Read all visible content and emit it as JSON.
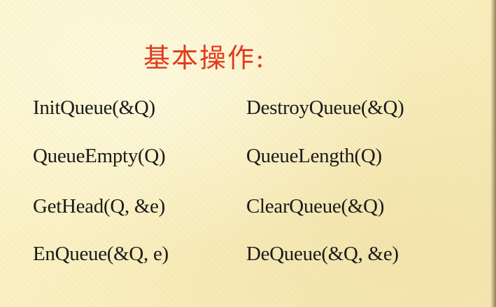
{
  "slide": {
    "title": "基本操作:",
    "operations": [
      "InitQueue(&Q)",
      "DestroyQueue(&Q)",
      "QueueEmpty(Q)",
      "QueueLength(Q)",
      "GetHead(Q, &e)",
      "ClearQueue(&Q)",
      "EnQueue(&Q, e)",
      "DeQueue(&Q, &e)"
    ],
    "colors": {
      "background": "#fbf4c8",
      "title": "#e23a1e",
      "text": "#1a1a1a"
    }
  }
}
